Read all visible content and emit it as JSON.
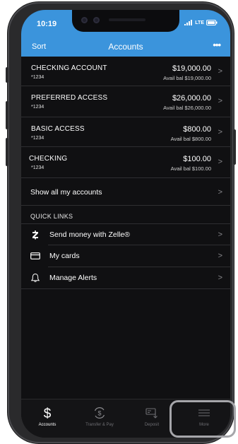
{
  "status_bar": {
    "time": "10:19",
    "network": "LTE"
  },
  "nav": {
    "left": "Sort",
    "title": "Accounts",
    "more": "•••"
  },
  "accounts": [
    {
      "name": "CHECKING ACCOUNT",
      "number": "*1234",
      "amount": "$19,000.00",
      "available": "Avail bal $19,000.00"
    },
    {
      "name": "PREFERRED ACCESS",
      "number": "*1234",
      "amount": "$26,000.00",
      "available": "Avail bal $26,000.00"
    },
    {
      "name": "BASIC ACCESS",
      "number": "*1234",
      "amount": "$800.00",
      "available": "Avail bal $800.00"
    },
    {
      "name": "CHECKING",
      "number": "*1234",
      "amount": "$100.00",
      "available": "Avail bal $100.00"
    }
  ],
  "show_all": "Show all my accounts",
  "quick_links": {
    "header": "QUICK LINKS",
    "items": [
      {
        "label": "Send money with Zelle®",
        "icon": "zelle-icon"
      },
      {
        "label": "My cards",
        "icon": "card-icon"
      },
      {
        "label": "Manage Alerts",
        "icon": "bell-icon"
      }
    ]
  },
  "chevron": ">",
  "tabs": [
    {
      "label": "Accounts",
      "icon": "dollar-icon",
      "active": true
    },
    {
      "label": "Transfer & Pay",
      "icon": "transfer-icon",
      "active": false
    },
    {
      "label": "Deposit",
      "icon": "deposit-icon",
      "active": false
    },
    {
      "label": "More",
      "icon": "menu-icon",
      "active": false
    }
  ],
  "colors": {
    "accent": "#3b94dc",
    "background": "#101012",
    "highlight": "#a6a6aa"
  }
}
